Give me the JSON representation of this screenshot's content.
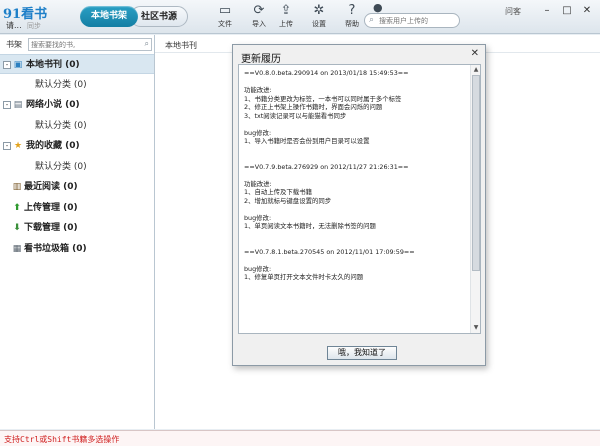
{
  "app": {
    "logo_text": "91看书",
    "user": "请...",
    "sync_label": "同步"
  },
  "tabs": [
    {
      "label": "本地书架",
      "active": true
    },
    {
      "label": "社区书源",
      "active": false
    }
  ],
  "toolbar": {
    "file_label": "文件",
    "import_label": "导入",
    "upload_label": "上传",
    "settings_label": "设置",
    "help_label": "帮助"
  },
  "top_search": {
    "placeholder": "搜索用户上传的"
  },
  "guest_label": "问客",
  "sidebar": {
    "title": "书架",
    "search_placeholder": "搜索要找的书,",
    "items": [
      {
        "label": "本地书刊 (0)",
        "icon": "bookshelf-icon",
        "level": 0,
        "expander": "-",
        "selected": true
      },
      {
        "label": "默认分类 (0)",
        "level": 1
      },
      {
        "label": "网络小说 (0)",
        "icon": "document-icon",
        "level": 0,
        "expander": "-"
      },
      {
        "label": "默认分类 (0)",
        "level": 1
      },
      {
        "label": "我的收藏 (0)",
        "icon": "star-icon",
        "level": 0,
        "expander": "-"
      },
      {
        "label": "默认分类 (0)",
        "level": 1
      },
      {
        "label": "最近阅读 (0)",
        "icon": "open-book-icon",
        "level": 0
      },
      {
        "label": "上传管理 (0)",
        "icon": "upload-arrow-icon",
        "level": 0
      },
      {
        "label": "下载管理 (0)",
        "icon": "download-icon",
        "level": 0
      },
      {
        "label": "看书垃圾箱 (0)",
        "icon": "trash-icon",
        "level": 0
      }
    ]
  },
  "main": {
    "header_label": "本地书刊"
  },
  "dialog": {
    "title": "更新履历",
    "confirm_label": "哦，我知道了",
    "content": "==V0.8.0.beta.290914 on 2013/01/18 15:49:53==\n\n功能改进:\n1、书籍分类更改为标签，一本书可以同时属于多个标签\n2、修正上书架上操作书籍时，界面会闪烁的问题\n3、txt阅读记录可以与能猫看书同步\n\nbug修改:\n1、导入书籍时是否会份到用户目录可以设置\n\n\n==V0.7.9.beta.276929 on 2012/11/27 21:26:31==\n\n功能改进:\n1、自动上传及下载书籍\n2、增加就标与键盘设置的同步\n\nbug修改:\n1、单页阅读文本书籍时，无法删除书签的问题\n\n\n==V0.7.8.1.beta.270545 on 2012/11/01 17:09:59==\n\nbug修改:\n1、修复单页打开文本文件时卡太久的问题"
  },
  "status_text": "支持Ctrl或Shift书籍多选操作"
}
